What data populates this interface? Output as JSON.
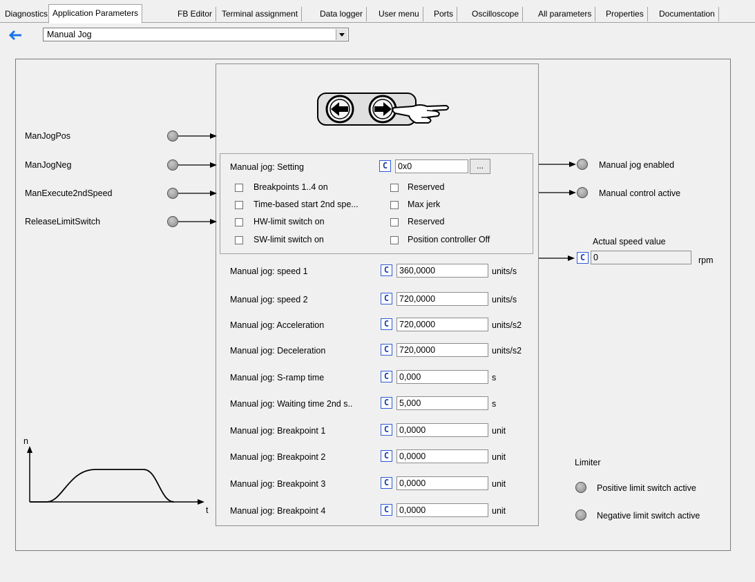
{
  "tabs": [
    {
      "label": "Diagnostics"
    },
    {
      "label": "Application Parameters"
    },
    {
      "label": "FB Editor"
    },
    {
      "label": "Terminal assignment"
    },
    {
      "label": "Data logger"
    },
    {
      "label": "User menu"
    },
    {
      "label": "Ports"
    },
    {
      "label": "Oscilloscope"
    },
    {
      "label": "All parameters"
    },
    {
      "label": "Properties"
    },
    {
      "label": "Documentation"
    }
  ],
  "active_tab": "Application Parameters",
  "view_selector": {
    "value": "Manual Jog"
  },
  "inputs": [
    {
      "label": "ManJogPos"
    },
    {
      "label": "ManJogNeg"
    },
    {
      "label": "ManExecute2ndSpeed"
    },
    {
      "label": "ReleaseLimitSwitch"
    }
  ],
  "setting": {
    "label": "Manual jog: Setting",
    "c_label": "C",
    "value": "0x0",
    "more_label": "...",
    "checkboxes_left": [
      {
        "label": "Breakpoints 1..4 on",
        "checked": false
      },
      {
        "label": "Time-based start 2nd spe...",
        "checked": false
      },
      {
        "label": "HW-limit switch on",
        "checked": false
      },
      {
        "label": "SW-limit switch on",
        "checked": false
      }
    ],
    "checkboxes_right": [
      {
        "label": "Reserved",
        "checked": false
      },
      {
        "label": "Max jerk",
        "checked": false
      },
      {
        "label": "Reserved",
        "checked": false
      },
      {
        "label": "Position controller Off",
        "checked": false
      }
    ]
  },
  "params": [
    {
      "label": "Manual jog: speed 1",
      "value": "360,0000",
      "unit": "units/s"
    },
    {
      "label": "Manual jog: speed 2",
      "value": "720,0000",
      "unit": "units/s"
    },
    {
      "label": "Manual jog: Acceleration",
      "value": "720,0000",
      "unit": "units/s2"
    },
    {
      "label": "Manual jog: Deceleration",
      "value": "720,0000",
      "unit": "units/s2"
    },
    {
      "label": "Manual jog: S-ramp time",
      "value": "0,000",
      "unit": "s"
    },
    {
      "label": "Manual jog: Waiting time 2nd s..",
      "value": "5,000",
      "unit": "s"
    },
    {
      "label": "Manual jog: Breakpoint 1",
      "value": "0,0000",
      "unit": "unit"
    },
    {
      "label": "Manual jog: Breakpoint 2",
      "value": "0,0000",
      "unit": "unit"
    },
    {
      "label": "Manual jog: Breakpoint 3",
      "value": "0,0000",
      "unit": "unit"
    },
    {
      "label": "Manual jog: Breakpoint 4",
      "value": "0,0000",
      "unit": "unit"
    }
  ],
  "outputs": [
    {
      "label": "Manual jog enabled"
    },
    {
      "label": "Manual control active"
    }
  ],
  "actual_speed": {
    "title": "Actual speed value",
    "c_label": "C",
    "value": "0",
    "unit": "rpm"
  },
  "limiter": {
    "title": "Limiter",
    "items": [
      {
        "label": "Positive limit switch active"
      },
      {
        "label": "Negative limit switch active"
      }
    ]
  },
  "profile_graph": {
    "y_axis": "n",
    "x_axis": "t"
  },
  "colors": {
    "accent": "#1c3fa8",
    "led": "#9a9a9a",
    "back_arrow": "#1e73e8"
  }
}
